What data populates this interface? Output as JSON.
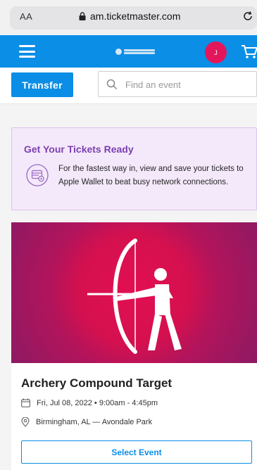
{
  "browser": {
    "aa_label": "AA",
    "url": "am.ticketmaster.com"
  },
  "header": {
    "avatar_initial": "J",
    "brand_color": "#0a8ee6",
    "logo_text": "The World Games"
  },
  "toolbar": {
    "transfer_label": "Transfer",
    "search_placeholder": "Find an event"
  },
  "info": {
    "title": "Get Your Tickets Ready",
    "text": "For the fastest way in, view and save your tickets to Apple Wallet to beat busy network connections."
  },
  "event": {
    "title": "Archery Compound Target",
    "date": "Fri, Jul 08, 2022 • 9:00am - 4:45pm",
    "location": "Birmingham, AL — Avondale Park",
    "select_label": "Select Event"
  }
}
